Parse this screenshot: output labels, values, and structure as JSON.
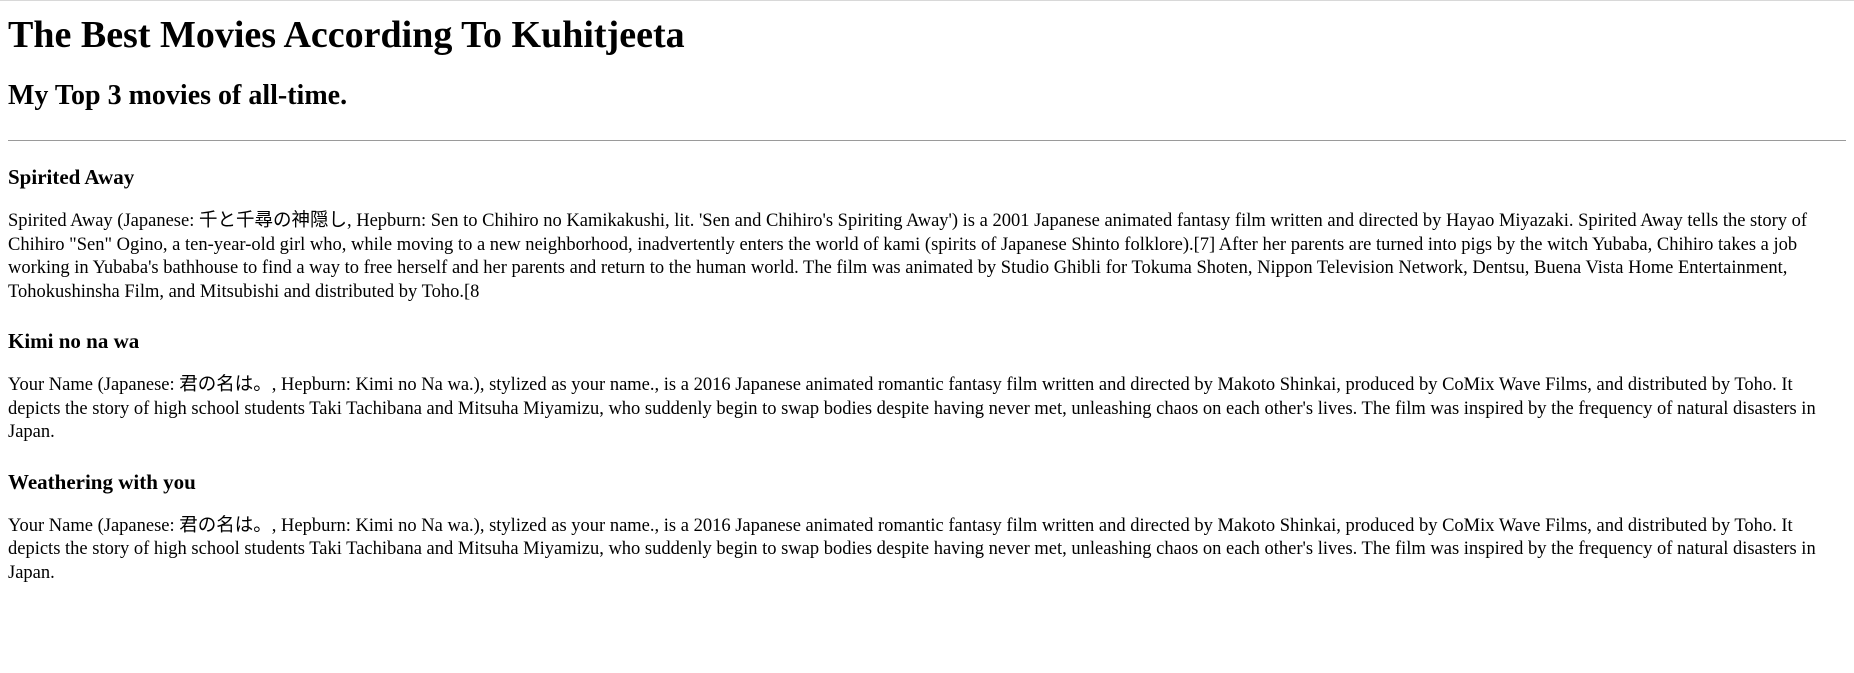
{
  "page": {
    "title": "The Best Movies According To Kuhitjeeta",
    "subtitle": "My Top 3 movies of all-time."
  },
  "movies": [
    {
      "title": "Spirited Away",
      "description": "Spirited Away (Japanese: 千と千尋の神隠し, Hepburn: Sen to Chihiro no Kamikakushi, lit. 'Sen and Chihiro's Spiriting Away') is a 2001 Japanese animated fantasy film written and directed by Hayao Miyazaki. Spirited Away tells the story of Chihiro \"Sen\" Ogino, a ten-year-old girl who, while moving to a new neighborhood, inadvertently enters the world of kami (spirits of Japanese Shinto folklore).[7] After her parents are turned into pigs by the witch Yubaba, Chihiro takes a job working in Yubaba's bathhouse to find a way to free herself and her parents and return to the human world. The film was animated by Studio Ghibli for Tokuma Shoten, Nippon Television Network, Dentsu, Buena Vista Home Entertainment, Tohokushinsha Film, and Mitsubishi and distributed by Toho.[8"
    },
    {
      "title": "Kimi no na wa",
      "description": "Your Name (Japanese: 君の名は。, Hepburn: Kimi no Na wa.), stylized as your name., is a 2016 Japanese animated romantic fantasy film written and directed by Makoto Shinkai, produced by CoMix Wave Films, and distributed by Toho. It depicts the story of high school students Taki Tachibana and Mitsuha Miyamizu, who suddenly begin to swap bodies despite having never met, unleashing chaos on each other's lives. The film was inspired by the frequency of natural disasters in Japan."
    },
    {
      "title": "Weathering with you",
      "description": "Your Name (Japanese: 君の名は。, Hepburn: Kimi no Na wa.), stylized as your name., is a 2016 Japanese animated romantic fantasy film written and directed by Makoto Shinkai, produced by CoMix Wave Films, and distributed by Toho. It depicts the story of high school students Taki Tachibana and Mitsuha Miyamizu, who suddenly begin to swap bodies despite having never met, unleashing chaos on each other's lives. The film was inspired by the frequency of natural disasters in Japan."
    }
  ]
}
